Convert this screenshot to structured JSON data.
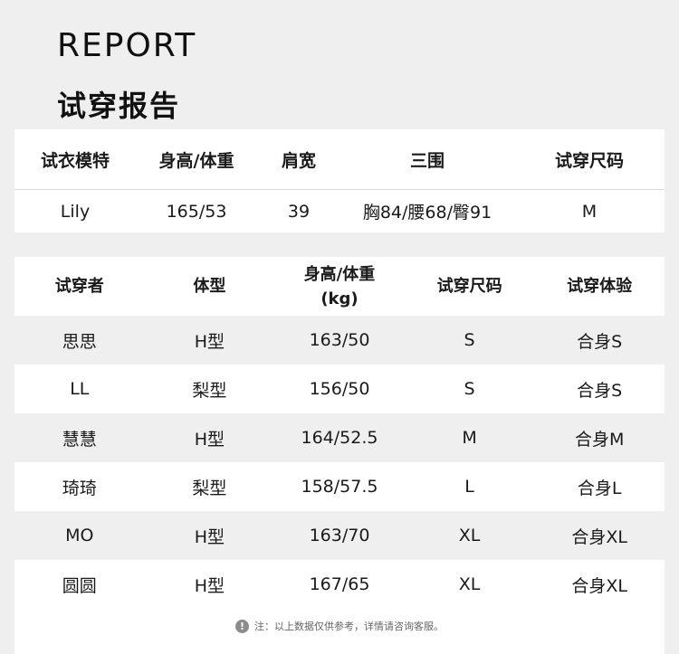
{
  "title_en": "REPORT",
  "title_zh": "试穿报告",
  "model_table": {
    "headers": [
      "试衣模特",
      "身高/体重",
      "肩宽",
      "三围",
      "试穿尺码"
    ],
    "row": [
      "Lily",
      "165/53",
      "39",
      "胸84/腰68/臀91",
      "M"
    ]
  },
  "tryon_table": {
    "headers": [
      "试穿者",
      "体型",
      "身高/体重",
      "(kg)",
      "试穿尺码",
      "试穿体验"
    ],
    "rows": [
      [
        "思思",
        "H型",
        "163/50",
        "S",
        "合身S"
      ],
      [
        "LL",
        "梨型",
        "156/50",
        "S",
        "合身S"
      ],
      [
        "慧慧",
        "H型",
        "164/52.5",
        "M",
        "合身M"
      ],
      [
        "琦琦",
        "梨型",
        "158/57.5",
        "L",
        "合身L"
      ],
      [
        "MO",
        "H型",
        "163/70",
        "XL",
        "合身XL"
      ],
      [
        "圆圆",
        "H型",
        "167/65",
        "XL",
        "合身XL"
      ]
    ]
  },
  "note": {
    "icon": "exclamation-icon",
    "icon_glyph": "!",
    "text": "注：以上数据仅供参考，详情请咨询客服。"
  }
}
